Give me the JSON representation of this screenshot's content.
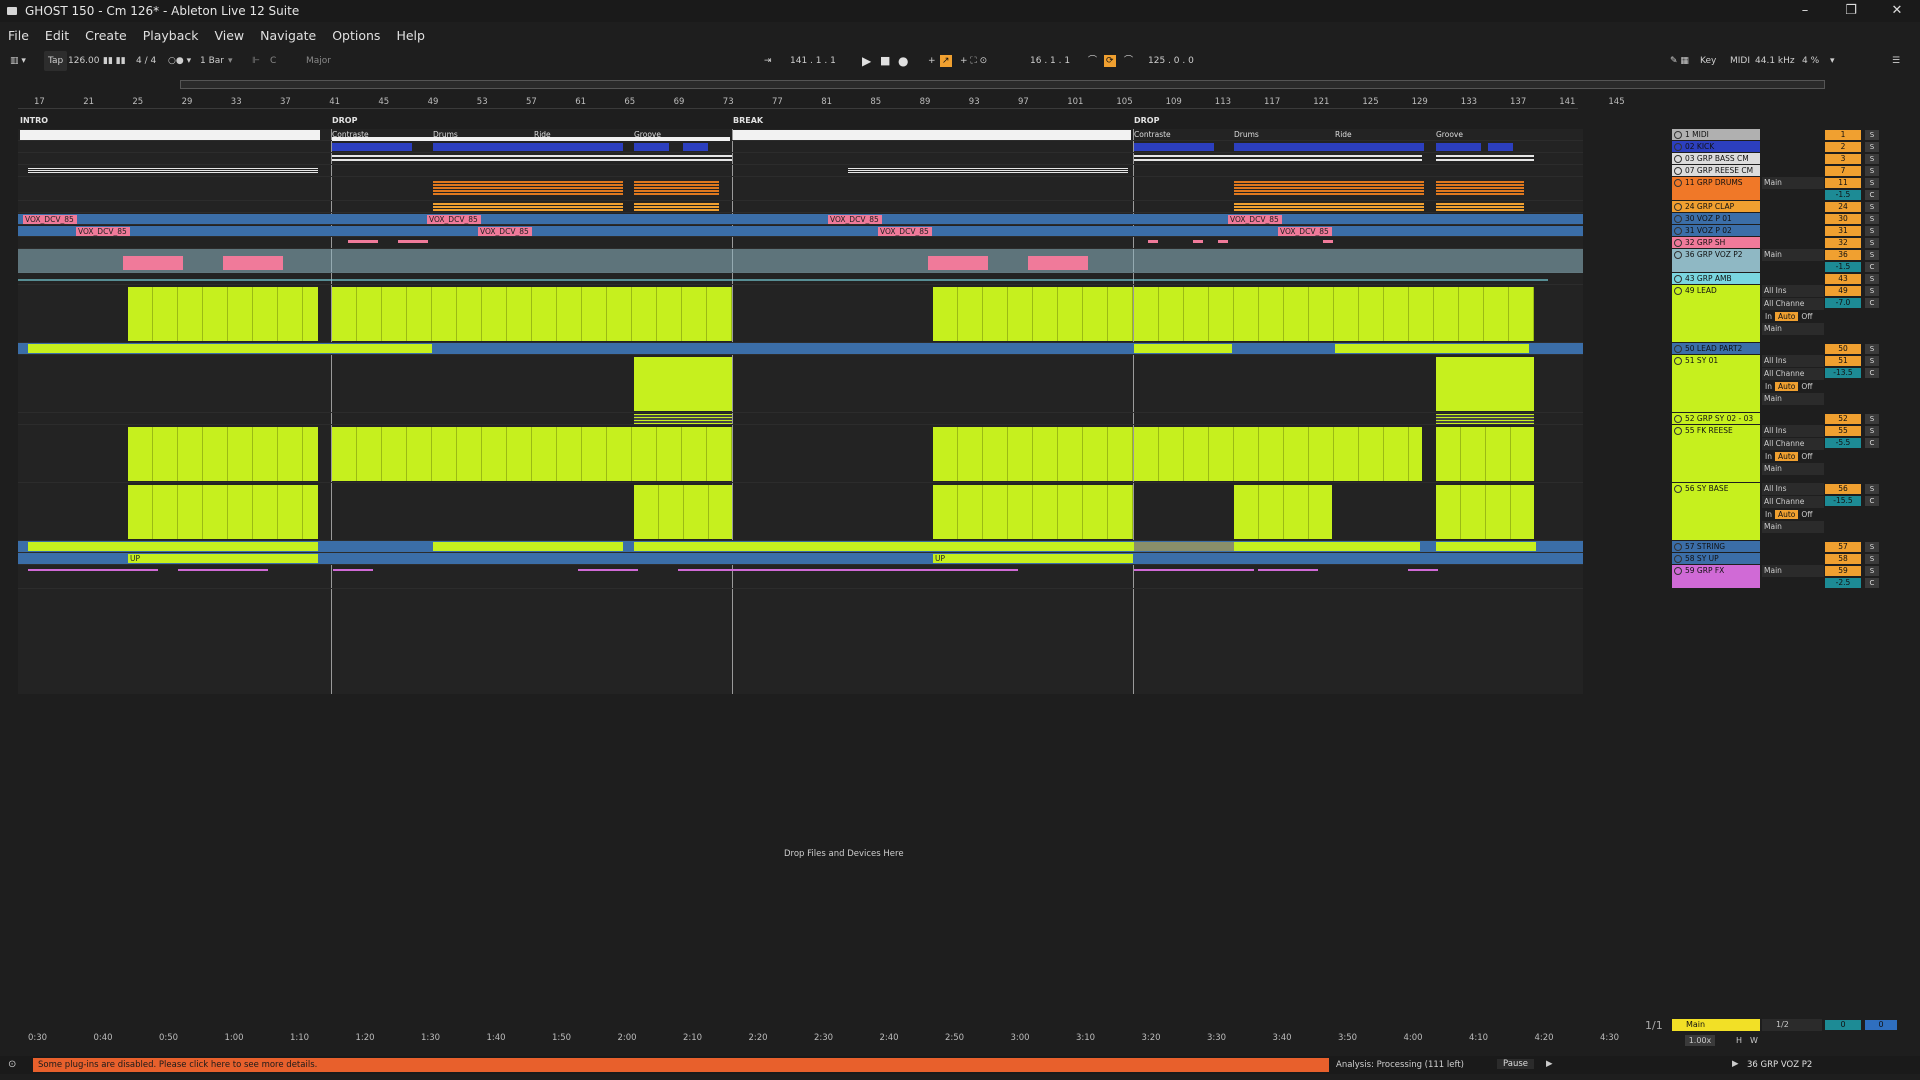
{
  "window": {
    "title": "GHOST 150 - Cm 126* - Ableton Live 12 Suite",
    "min": "–",
    "max": "❐",
    "close": "✕"
  },
  "menu": [
    "File",
    "Edit",
    "Create",
    "Playback",
    "View",
    "Navigate",
    "Options",
    "Help"
  ],
  "control": {
    "tap": "Tap",
    "tempo": "126.00",
    "signature": "4 / 4",
    "quantize": "1 Bar",
    "key": "C",
    "scale": "Major",
    "position": "141 .  1 .  1",
    "loop_start": "16 .  1 .  1",
    "loop_length": "125 .  0 .  0",
    "key_label": "Key",
    "midi_label": "MIDI",
    "sample_rate": "44.1 kHz",
    "cpu": "4 %"
  },
  "ruler": [
    "17",
    "21",
    "25",
    "29",
    "33",
    "37",
    "41",
    "45",
    "49",
    "53",
    "57",
    "61",
    "65",
    "69",
    "73",
    "77",
    "81",
    "85",
    "89",
    "93",
    "97",
    "101",
    "105",
    "109",
    "113",
    "117",
    "121",
    "125",
    "129",
    "133",
    "137",
    "141",
    "145"
  ],
  "locators": [
    "INTRO",
    "DROP",
    "BREAK",
    "DROP"
  ],
  "sublabels": [
    "Contraste",
    "Drums",
    "Ride",
    "Groove",
    "Contraste",
    "Drums",
    "Ride",
    "Groove"
  ],
  "clip_names": {
    "vox": "VOX_DCV_85",
    "up": "UP"
  },
  "tracks": [
    {
      "name": "1 MIDI",
      "num": "1",
      "color": "#b0b0b0"
    },
    {
      "name": "02 KICK",
      "num": "2",
      "color": "#2c3fbf"
    },
    {
      "name": "03 GRP BASS CM",
      "num": "3",
      "color": "#dcdcdc"
    },
    {
      "name": "07 GRP REESE CM",
      "num": "7",
      "color": "#dcdcdc"
    },
    {
      "name": "11 GRP DRUMS",
      "num": "11",
      "color": "#f07828",
      "vol": "-1.5",
      "route": "Main"
    },
    {
      "name": "24 GRP CLAP",
      "num": "24",
      "color": "#f0a030"
    },
    {
      "name": "30 VOZ P 01",
      "num": "30",
      "color": "#3b6ea8"
    },
    {
      "name": "31 VOZ P 02",
      "num": "31",
      "color": "#3b6ea8"
    },
    {
      "name": "32 GRP SH",
      "num": "32",
      "color": "#f07a9a"
    },
    {
      "name": "36 GRP VOZ P2",
      "num": "36",
      "color": "#8fb8c4",
      "vol": "-1.5",
      "route": "Main"
    },
    {
      "name": "43 GRP AMB",
      "num": "43",
      "color": "#7ad6e0"
    },
    {
      "name": "49 LEAD",
      "num": "49",
      "color": "#c6f01e",
      "vol": "-7.0"
    },
    {
      "name": "50 LEAD PART2",
      "num": "50",
      "color": "#3b6ea8"
    },
    {
      "name": "51 SY 01",
      "num": "51",
      "color": "#c6f01e",
      "vol": "-13.5"
    },
    {
      "name": "52 GRP SY 02 - 03",
      "num": "52",
      "color": "#c6f01e"
    },
    {
      "name": "55 FK REESE",
      "num": "55",
      "color": "#c6f01e",
      "vol": "-5.5"
    },
    {
      "name": "56 SY BASE",
      "num": "56",
      "color": "#c6f01e",
      "vol": "-15.5"
    },
    {
      "name": "57 STRING",
      "num": "57",
      "color": "#3b6ea8"
    },
    {
      "name": "58 SY UP",
      "num": "58",
      "color": "#3b6ea8"
    },
    {
      "name": "59 GRP FX",
      "num": "59",
      "color": "#d06ad6",
      "vol": "-2.5",
      "route": "Main"
    }
  ],
  "io": {
    "in": "All Ins",
    "channel": "All Channe",
    "monitor_in": "In",
    "monitor_auto": "Auto",
    "monitor_off": "Off",
    "route": "Main",
    "solo": "S",
    "pan": "C"
  },
  "timeline": [
    "0:30",
    "0:40",
    "0:50",
    "1:00",
    "1:10",
    "1:20",
    "1:30",
    "1:40",
    "1:50",
    "2:00",
    "2:10",
    "2:20",
    "2:30",
    "2:40",
    "2:50",
    "3:00",
    "3:10",
    "3:20",
    "3:30",
    "3:40",
    "3:50",
    "4:00",
    "4:10",
    "4:20",
    "4:30"
  ],
  "main_track": {
    "name": "Main",
    "quant": "1/2",
    "vol": "0",
    "pan": "0",
    "zoom": "1/1",
    "speed": "1.00x",
    "h": "H",
    "w": "W"
  },
  "drop_text": "Drop Files and Devices Here",
  "status": {
    "warning": "Some plug-ins are disabled. Please click here to see more details.",
    "analysis": "Analysis: Processing (111 left)",
    "pause": "Pause",
    "selected_track": "36 GRP VOZ P2"
  }
}
